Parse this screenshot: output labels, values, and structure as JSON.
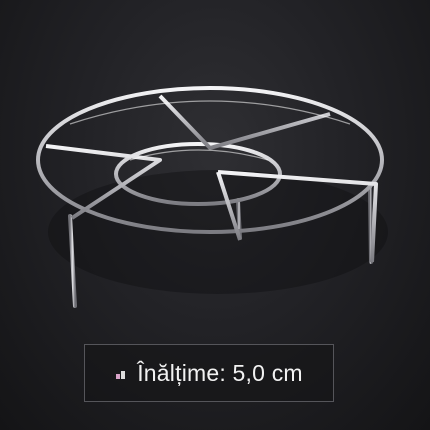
{
  "caption": {
    "text": "Înălțime: 5,0 cm",
    "icon": "dimension-marker-icon",
    "icon_color": "#d9a3c8"
  },
  "photo": {
    "subject": "stainless steel steamer rack",
    "metal_color": "#d8d8dc",
    "background_color": "#1c1c1f"
  }
}
